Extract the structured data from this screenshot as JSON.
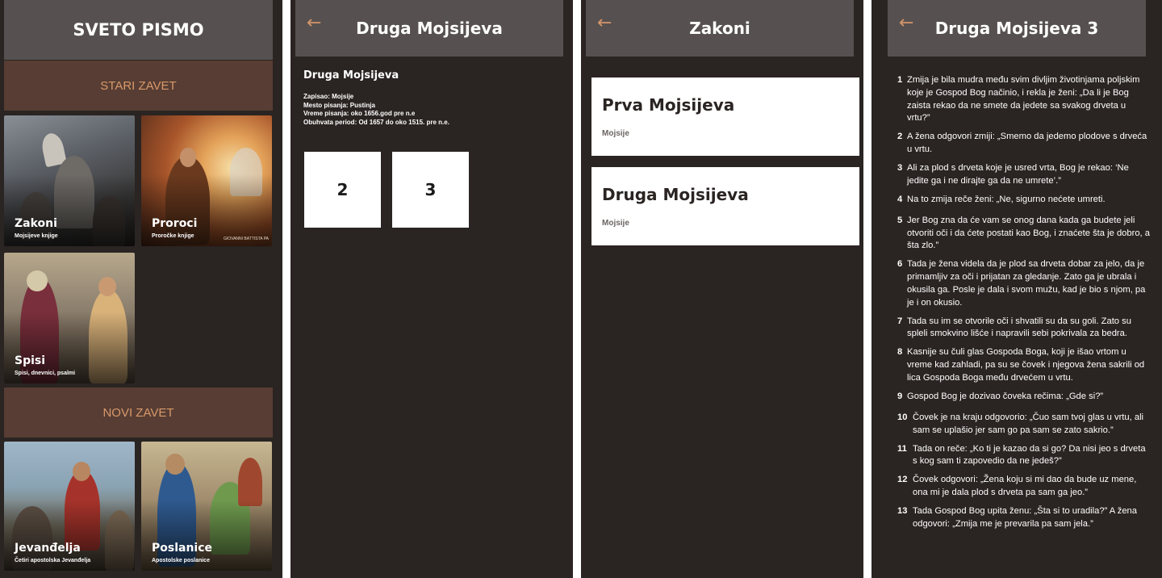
{
  "screen1": {
    "title": "SVETO PISMO",
    "old_testament": "STARI ZAVET",
    "new_testament": "NOVI ZAVET",
    "tiles": [
      {
        "title": "Zakoni",
        "subtitle": "Mojsijeve knjige"
      },
      {
        "title": "Proroci",
        "subtitle": "Proročke knjige",
        "credit": "GIOVANNI BATTISTA PA"
      },
      {
        "title": "Spisi",
        "subtitle": "Spisi, dnevnici, psalmi"
      },
      {
        "title": "Jevanđelja",
        "subtitle": "Četiri apostolska Jevanđelja"
      },
      {
        "title": "Poslanice",
        "subtitle": "Apostolske poslanice"
      }
    ]
  },
  "screen2": {
    "back_icon": "←",
    "title": "Druga Mojsijeva",
    "book": "Druga Mojsijeva",
    "meta": [
      "Zapisao: Mojsije",
      "Mesto pisanja: Pustinja",
      "Vreme pisanja: oko 1656.god pre n.e",
      "Obuhvata period: Od 1657 do oko 1515. pre n.e."
    ],
    "chapters": [
      "2",
      "3"
    ]
  },
  "screen3": {
    "back_icon": "←",
    "title": "Zakoni",
    "books": [
      {
        "title": "Prva Mojsijeva",
        "author": "Mojsije"
      },
      {
        "title": "Druga Mojsijeva",
        "author": "Mojsije"
      }
    ]
  },
  "screen4": {
    "back_icon": "←",
    "title": "Druga Mojsijeva 3",
    "verses": [
      {
        "n": "1",
        "text": "Zmija je bila mudra među svim divljim životinjama poljskim koje je Gospod Bog načinio, i rekla je ženi: „Da li je Bog zaista rekao da ne smete da jedete sa svakog drveta u vrtu?”"
      },
      {
        "n": "2",
        "text": "A žena odgovori zmiji: „Smemo da jedemo plodove s drveća u vrtu."
      },
      {
        "n": "3",
        "text": "Ali za plod s drveta koje je usred vrta, Bog je rekao: ‘Ne jedite ga i ne dirajte ga da ne umrete’.”"
      },
      {
        "n": "4",
        "text": "Na to zmija reče ženi: „Ne, sigurno nećete umreti."
      },
      {
        "n": "5",
        "text": "Jer Bog zna da će vam se onog dana kada ga budete jeli otvoriti oči i da ćete postati kao Bog, i znaćete šta je dobro, a šta zlo.”"
      },
      {
        "n": "6",
        "text": "Tada je žena videla da je plod sa drveta dobar za jelo, da je primamljiv za oči i prijatan za gledanje. Zato ga je ubrala i okusila ga. Posle je dala i svom mužu, kad je bio s njom, pa je i on okusio."
      },
      {
        "n": "7",
        "text": "Tada su im se otvorile oči i shvatili su da su goli. Zato su spleli smokvino lišće i napravili sebi pokrivala za bedra."
      },
      {
        "n": "8",
        "text": "Kasnije su čuli glas Gospoda Boga, koji je išao vrtom u vreme kad zahladi, pa su se čovek i njegova žena sakrili od lica Gospoda Boga među drvećem u vrtu."
      },
      {
        "n": "9",
        "text": "Gospod Bog je dozivao čoveka rečima: „Gde si?”"
      },
      {
        "n": "10",
        "text": "Čovek je na kraju odgovorio: „Čuo sam tvoj glas u vrtu, ali sam se uplašio jer sam go pa sam se zato sakrio.”"
      },
      {
        "n": "11",
        "text": "Tada on reče: „Ko ti je kazao da si go? Da nisi jeo s drveta s kog sam ti zapovedio da ne jedeš?”"
      },
      {
        "n": "12",
        "text": "Čovek odgovori: „Žena koju si mi dao da bude uz mene, ona mi je dala plod s drveta pa sam ga jeo.”"
      },
      {
        "n": "13",
        "text": "Tada Gospod Bog upita ženu: „Šta si to uradila?” A žena odgovori: „Zmija me je prevarila pa sam jela.”"
      }
    ]
  }
}
